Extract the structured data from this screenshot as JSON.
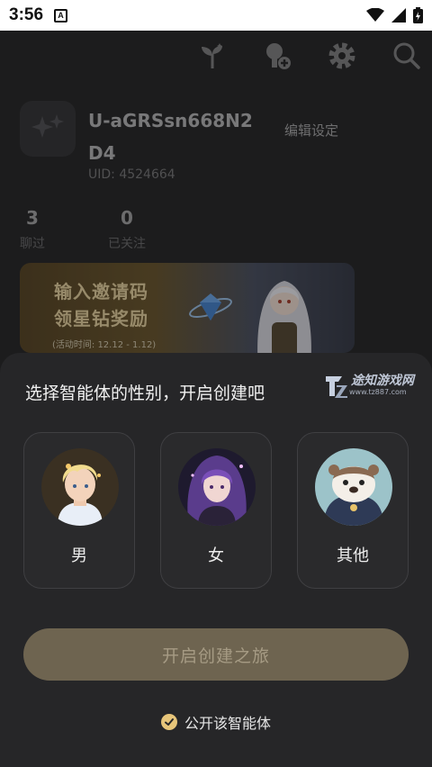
{
  "status": {
    "time": "3:56",
    "notification_badge": "A"
  },
  "toolbar": {
    "icons": [
      "sprout-icon",
      "agent-add-icon",
      "gear-icon",
      "search-icon"
    ]
  },
  "profile": {
    "username": "U-aGRSsn668N2D4",
    "uid": "UID: 4524664",
    "edit_label": "编辑设定"
  },
  "stats": [
    {
      "value": "3",
      "label": "聊过"
    },
    {
      "value": "0",
      "label": "已关注"
    }
  ],
  "banner": {
    "line1": "输入邀请码",
    "line2": "领星钻奖励",
    "date": "(活动时间: 12.12 - 1.12)"
  },
  "sheet": {
    "title": "选择智能体的性别，开启创建吧",
    "watermark_name": "途知游戏网",
    "watermark_url": "www.tz887.com",
    "options": [
      {
        "label": "男"
      },
      {
        "label": "女"
      },
      {
        "label": "其他"
      }
    ],
    "cta_label": "开启创建之旅",
    "public_label": "公开该智能体"
  },
  "colors": {
    "accent": "#e7c57a",
    "cta_bg": "#6e6450",
    "sheet_bg": "#262628"
  }
}
